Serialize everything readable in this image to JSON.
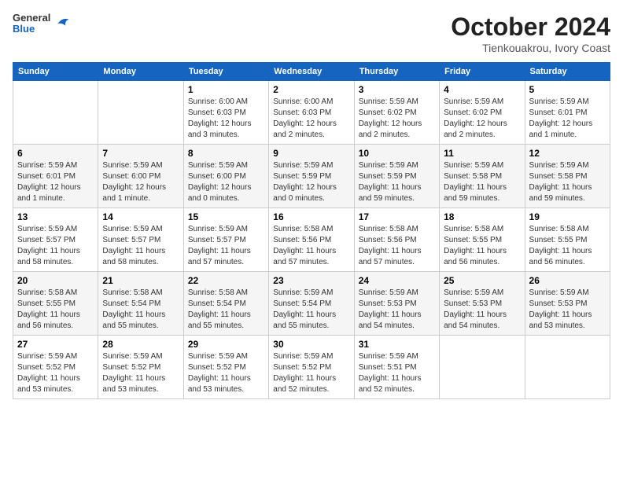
{
  "header": {
    "logo": {
      "general": "General",
      "blue": "Blue"
    },
    "title": "October 2024",
    "location": "Tienkouakrou, Ivory Coast"
  },
  "days_of_week": [
    "Sunday",
    "Monday",
    "Tuesday",
    "Wednesday",
    "Thursday",
    "Friday",
    "Saturday"
  ],
  "weeks": [
    [
      {
        "day": null
      },
      {
        "day": null
      },
      {
        "day": 1,
        "sunrise": "6:00 AM",
        "sunset": "6:03 PM",
        "daylight": "12 hours and 3 minutes."
      },
      {
        "day": 2,
        "sunrise": "6:00 AM",
        "sunset": "6:03 PM",
        "daylight": "12 hours and 2 minutes."
      },
      {
        "day": 3,
        "sunrise": "5:59 AM",
        "sunset": "6:02 PM",
        "daylight": "12 hours and 2 minutes."
      },
      {
        "day": 4,
        "sunrise": "5:59 AM",
        "sunset": "6:02 PM",
        "daylight": "12 hours and 2 minutes."
      },
      {
        "day": 5,
        "sunrise": "5:59 AM",
        "sunset": "6:01 PM",
        "daylight": "12 hours and 1 minute."
      }
    ],
    [
      {
        "day": 6,
        "sunrise": "5:59 AM",
        "sunset": "6:01 PM",
        "daylight": "12 hours and 1 minute."
      },
      {
        "day": 7,
        "sunrise": "5:59 AM",
        "sunset": "6:00 PM",
        "daylight": "12 hours and 1 minute."
      },
      {
        "day": 8,
        "sunrise": "5:59 AM",
        "sunset": "6:00 PM",
        "daylight": "12 hours and 0 minutes."
      },
      {
        "day": 9,
        "sunrise": "5:59 AM",
        "sunset": "5:59 PM",
        "daylight": "12 hours and 0 minutes."
      },
      {
        "day": 10,
        "sunrise": "5:59 AM",
        "sunset": "5:59 PM",
        "daylight": "11 hours and 59 minutes."
      },
      {
        "day": 11,
        "sunrise": "5:59 AM",
        "sunset": "5:58 PM",
        "daylight": "11 hours and 59 minutes."
      },
      {
        "day": 12,
        "sunrise": "5:59 AM",
        "sunset": "5:58 PM",
        "daylight": "11 hours and 59 minutes."
      }
    ],
    [
      {
        "day": 13,
        "sunrise": "5:59 AM",
        "sunset": "5:57 PM",
        "daylight": "11 hours and 58 minutes."
      },
      {
        "day": 14,
        "sunrise": "5:59 AM",
        "sunset": "5:57 PM",
        "daylight": "11 hours and 58 minutes."
      },
      {
        "day": 15,
        "sunrise": "5:59 AM",
        "sunset": "5:57 PM",
        "daylight": "11 hours and 57 minutes."
      },
      {
        "day": 16,
        "sunrise": "5:58 AM",
        "sunset": "5:56 PM",
        "daylight": "11 hours and 57 minutes."
      },
      {
        "day": 17,
        "sunrise": "5:58 AM",
        "sunset": "5:56 PM",
        "daylight": "11 hours and 57 minutes."
      },
      {
        "day": 18,
        "sunrise": "5:58 AM",
        "sunset": "5:55 PM",
        "daylight": "11 hours and 56 minutes."
      },
      {
        "day": 19,
        "sunrise": "5:58 AM",
        "sunset": "5:55 PM",
        "daylight": "11 hours and 56 minutes."
      }
    ],
    [
      {
        "day": 20,
        "sunrise": "5:58 AM",
        "sunset": "5:55 PM",
        "daylight": "11 hours and 56 minutes."
      },
      {
        "day": 21,
        "sunrise": "5:58 AM",
        "sunset": "5:54 PM",
        "daylight": "11 hours and 55 minutes."
      },
      {
        "day": 22,
        "sunrise": "5:58 AM",
        "sunset": "5:54 PM",
        "daylight": "11 hours and 55 minutes."
      },
      {
        "day": 23,
        "sunrise": "5:59 AM",
        "sunset": "5:54 PM",
        "daylight": "11 hours and 55 minutes."
      },
      {
        "day": 24,
        "sunrise": "5:59 AM",
        "sunset": "5:53 PM",
        "daylight": "11 hours and 54 minutes."
      },
      {
        "day": 25,
        "sunrise": "5:59 AM",
        "sunset": "5:53 PM",
        "daylight": "11 hours and 54 minutes."
      },
      {
        "day": 26,
        "sunrise": "5:59 AM",
        "sunset": "5:53 PM",
        "daylight": "11 hours and 53 minutes."
      }
    ],
    [
      {
        "day": 27,
        "sunrise": "5:59 AM",
        "sunset": "5:52 PM",
        "daylight": "11 hours and 53 minutes."
      },
      {
        "day": 28,
        "sunrise": "5:59 AM",
        "sunset": "5:52 PM",
        "daylight": "11 hours and 53 minutes."
      },
      {
        "day": 29,
        "sunrise": "5:59 AM",
        "sunset": "5:52 PM",
        "daylight": "11 hours and 53 minutes."
      },
      {
        "day": 30,
        "sunrise": "5:59 AM",
        "sunset": "5:52 PM",
        "daylight": "11 hours and 52 minutes."
      },
      {
        "day": 31,
        "sunrise": "5:59 AM",
        "sunset": "5:51 PM",
        "daylight": "11 hours and 52 minutes."
      },
      {
        "day": null
      },
      {
        "day": null
      }
    ]
  ]
}
